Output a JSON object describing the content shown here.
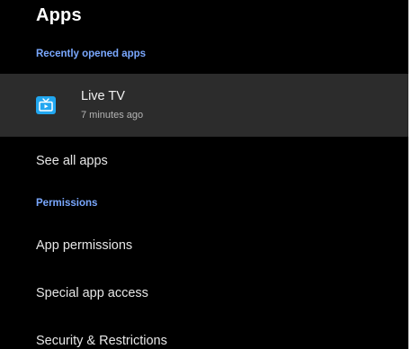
{
  "title": "Apps",
  "sections": {
    "recent": {
      "header": "Recently opened apps",
      "app": {
        "name": "Live TV",
        "subtitle": "7 minutes ago",
        "icon": "tv-icon",
        "icon_color": "#21a7f0"
      }
    },
    "see_all": "See all apps",
    "permissions": {
      "header": "Permissions",
      "items": [
        "App permissions",
        "Special app access",
        "Security & Restrictions"
      ]
    }
  },
  "colors": {
    "background": "#000000",
    "highlight_row": "#2c2c2c",
    "section_header": "#7aa8ff",
    "text_primary": "#e6e6e6",
    "text_secondary": "#b5b5b5"
  }
}
